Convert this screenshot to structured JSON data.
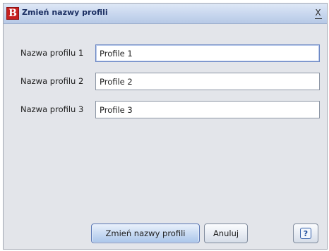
{
  "window": {
    "title": "Zmień nazwy profili",
    "app_icon_letter": "B",
    "close_glyph": "X"
  },
  "form": {
    "rows": [
      {
        "label": "Nazwa profilu 1",
        "value": "Profile 1"
      },
      {
        "label": "Nazwa profilu 2",
        "value": "Profile 2"
      },
      {
        "label": "Nazwa profilu 3",
        "value": "Profile 3"
      }
    ]
  },
  "buttons": {
    "rename_label": "Zmień nazwy profili",
    "cancel_label": "Anuluj",
    "help_glyph": "?"
  },
  "icons": {
    "app": "app-logo-icon",
    "close": "close-icon",
    "help": "help-icon"
  },
  "colors": {
    "window_bg": "#e3e5ea",
    "titlebar": "#c7d6ee",
    "title_text": "#1b2f62",
    "app_icon_bg": "#c62020",
    "primary_button": "#abc6ea"
  }
}
